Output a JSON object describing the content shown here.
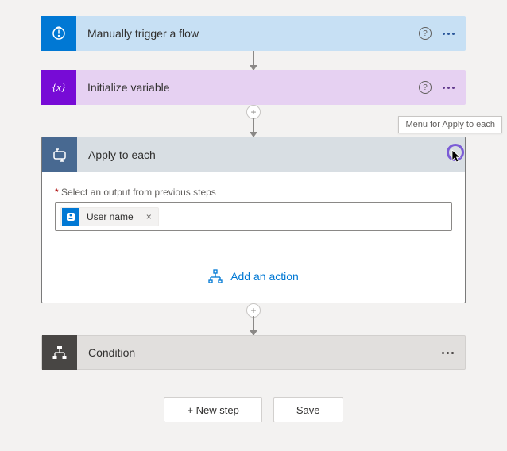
{
  "trigger": {
    "title": "Manually trigger a flow"
  },
  "initvar": {
    "title": "Initialize variable"
  },
  "apply": {
    "title": "Apply to each",
    "field_label": "Select an output from previous steps",
    "token": "User name",
    "add_action": "Add an action"
  },
  "condition": {
    "title": "Condition"
  },
  "buttons": {
    "newstep": "+ New step",
    "save": "Save"
  },
  "tooltip": "Menu for Apply to each"
}
